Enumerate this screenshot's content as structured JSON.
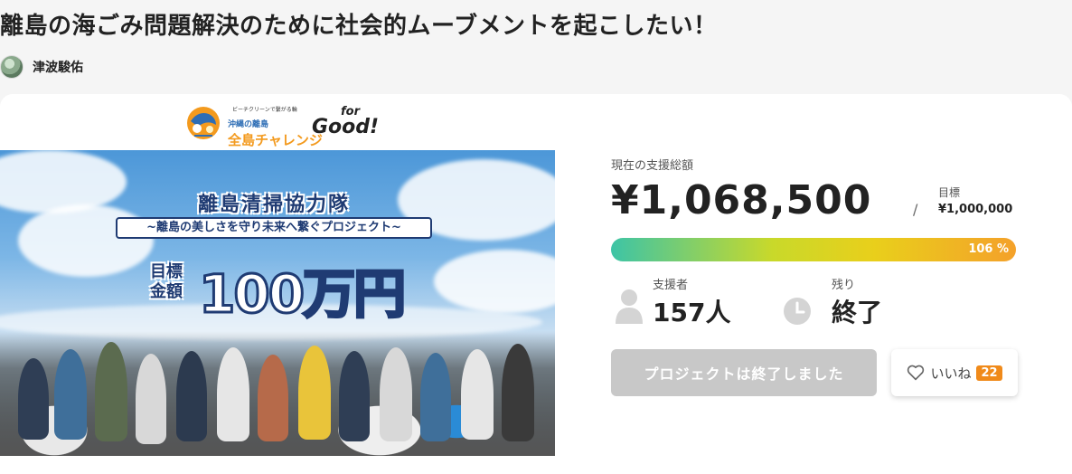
{
  "project": {
    "title": "離島の海ごみ問題解決のために社会的ムーブメントを起こしたい！",
    "owner": "津波駿佑"
  },
  "logos": {
    "partner_small": "ビーチクリーンで繋がる輪",
    "partner_name_blue": "沖縄の離島",
    "partner_name_orange": "全島チャレンジ",
    "for_text": "for",
    "good_text": "Good!"
  },
  "hero": {
    "banner_title": "離島清掃協力隊",
    "banner_subtitle": "~離島の美しさを守り未来へ繋ぐプロジェクト~",
    "goal_label": "目標金額",
    "goal_amount": "100万円"
  },
  "funding": {
    "total_label": "現在の支援総額",
    "total_amount": "¥1,068,500",
    "goal_label": "目標",
    "goal_amount": "¥1,000,000",
    "progress_percent_text": "106 %",
    "progress_fraction": 1.0,
    "supporters_label": "支援者",
    "supporters_value": "157人",
    "remaining_label": "残り",
    "remaining_value": "終了"
  },
  "actions": {
    "ended_button": "プロジェクトは終了しました",
    "like_label": "いいね",
    "like_count": "22"
  },
  "colors": {
    "accent_orange": "#f08a1a",
    "progress_start": "#3dc4a6",
    "progress_end": "#f4a12a",
    "disabled_button": "#c8c8c8"
  }
}
